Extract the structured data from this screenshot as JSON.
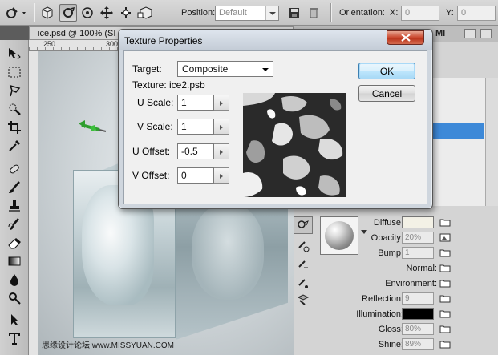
{
  "options_bar": {
    "position_label": "Position:",
    "position_value": "Default",
    "orientation_label": "Orientation:",
    "x_label": "X:",
    "x_value": "0",
    "y_label": "Y:",
    "y_value": "0"
  },
  "document": {
    "tab_title": "ice.psd @ 100% (SI",
    "ruler_marks": [
      "250",
      "300"
    ]
  },
  "right_panel": {
    "tab_label": "MI",
    "properties": {
      "diffuse_label": "Diffuse:",
      "opacity_label": "Opacity:",
      "opacity_value": "20%",
      "bump_label": "Bump:",
      "bump_value": "1",
      "normal_label": "Normal:",
      "environment_label": "Environment:",
      "reflection_label": "Reflection:",
      "reflection_value": "9",
      "illumination_label": "Illumination:",
      "gloss_label": "Gloss:",
      "gloss_value": "80%",
      "shine_label": "Shine:",
      "shine_value": "89%"
    },
    "colors": {
      "diffuse": "#f3f1e6",
      "illumination": "#000000",
      "selection": "#3d89d8"
    }
  },
  "dialog": {
    "title": "Texture Properties",
    "target_label": "Target:",
    "target_value": "Composite",
    "texture_label": "Texture: ice2.psb",
    "u_scale_label": "U Scale:",
    "u_scale_value": "1",
    "v_scale_label": "V Scale:",
    "v_scale_value": "1",
    "u_offset_label": "U Offset:",
    "u_offset_value": "-0.5",
    "v_offset_label": "V Offset:",
    "v_offset_value": "0",
    "ok_label": "OK",
    "cancel_label": "Cancel"
  },
  "watermark": "思缘设计论坛 www.MISSYUAN.COM"
}
